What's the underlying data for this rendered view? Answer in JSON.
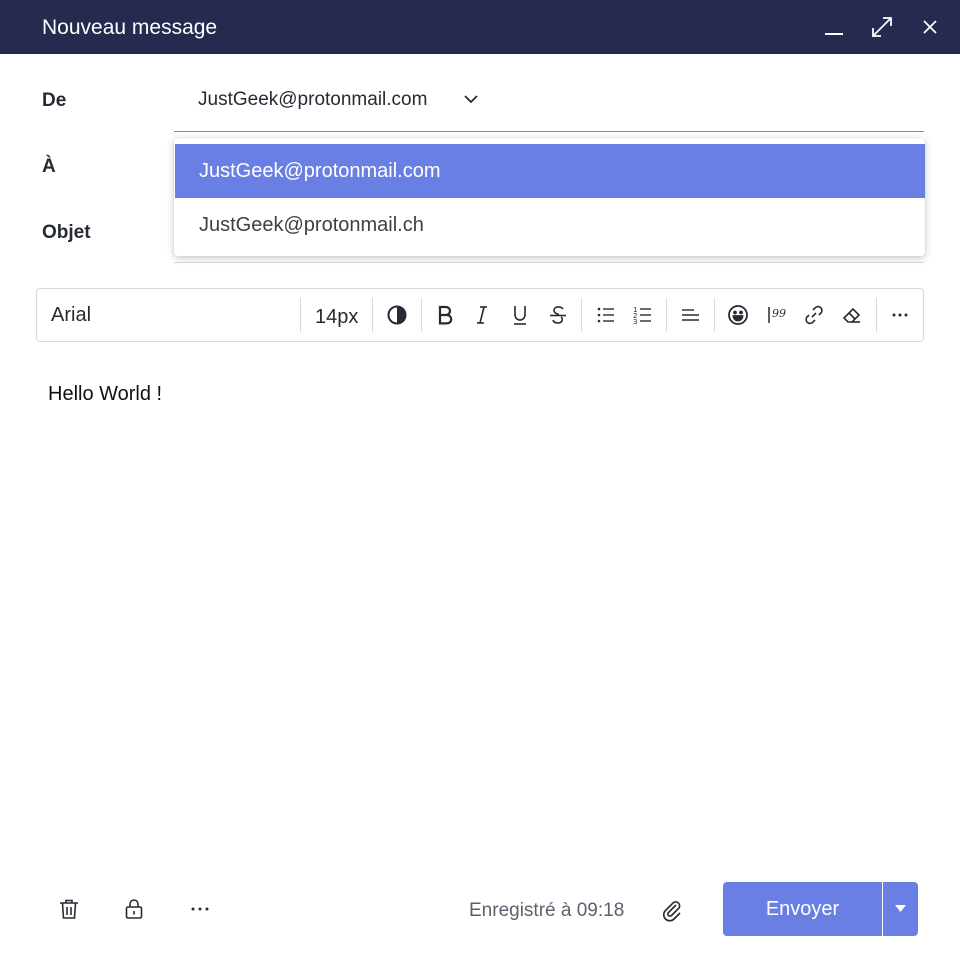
{
  "window": {
    "title": "Nouveau message",
    "controls": [
      "minimize-icon",
      "maximize-icon",
      "close-icon"
    ]
  },
  "fields": {
    "from_label": "De",
    "from_value": "JustGeek@protonmail.com",
    "to_label": "À",
    "subject_label": "Objet"
  },
  "from_dropdown": {
    "options": [
      {
        "label": "JustGeek@protonmail.com",
        "selected": true
      },
      {
        "label": "JustGeek@protonmail.ch",
        "selected": false
      }
    ]
  },
  "toolbar": {
    "font": "Arial",
    "size": "14px",
    "buttons": [
      "contrast-icon",
      "bold-icon",
      "italic-icon",
      "underline-icon",
      "strikethrough-icon",
      "bullet-list-icon",
      "numbered-list-icon",
      "align-left-icon",
      "emoji-icon",
      "quote-icon",
      "link-icon",
      "eraser-icon",
      "more-icon"
    ]
  },
  "editor": {
    "body": "Hello World !"
  },
  "footer": {
    "icons": [
      "trash-icon",
      "lock-icon",
      "more-icon",
      "attachment-icon"
    ],
    "saved_text": "Enregistré à 09:18",
    "send_label": "Envoyer"
  },
  "colors": {
    "titlebar": "#262a4f",
    "accent": "#6a7fe3",
    "focus_underline": "#6d8fc7",
    "border": "#d6d9e0"
  }
}
